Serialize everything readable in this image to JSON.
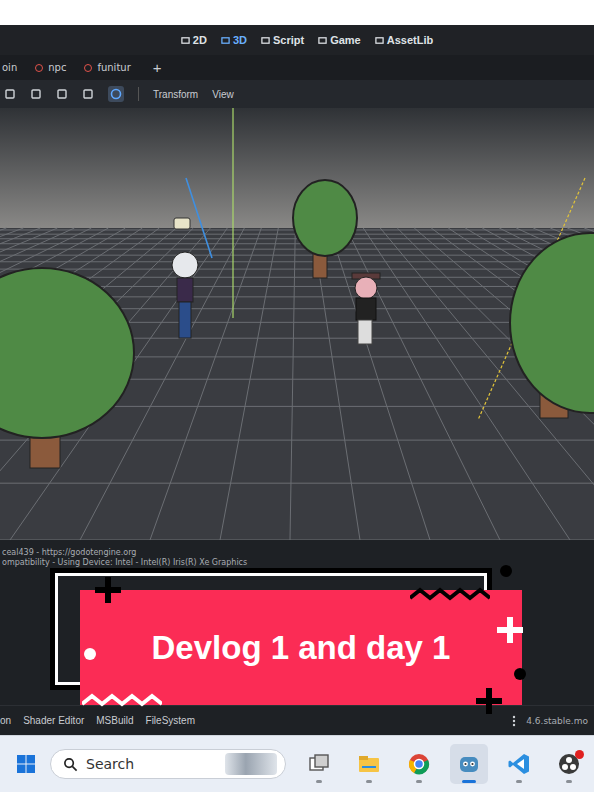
{
  "editor": {
    "main_tabs": [
      {
        "label": "2D",
        "selected": false
      },
      {
        "label": "3D",
        "selected": true
      },
      {
        "label": "Script",
        "selected": false
      },
      {
        "label": "Game",
        "selected": false
      },
      {
        "label": "AssetLib",
        "selected": false
      }
    ],
    "scene_tabs": [
      {
        "label": "oin",
        "icon": false
      },
      {
        "label": "npc",
        "icon": true
      },
      {
        "label": "funitur",
        "icon": true
      }
    ],
    "add_tab": "+",
    "toolbar": {
      "menus": [
        "Transform",
        "View"
      ]
    },
    "output": {
      "lines": [
        "ceal439 - https://godotengine.org",
        "ompatibility - Using Device: Intel - Intel(R) Iris(R) Xe Graphics"
      ]
    },
    "bottom_tabs": [
      {
        "label": "on"
      },
      {
        "label": "Shader Editor"
      },
      {
        "label": "MSBuild"
      },
      {
        "label": "FileSystem"
      }
    ],
    "version": "4.6.stable.mo"
  },
  "overlay": {
    "title": "Devlog 1 and day 1"
  },
  "taskbar": {
    "search": {
      "placeholder": "Search"
    },
    "apps": [
      {
        "kind": "task-view",
        "active": false,
        "badge": false
      },
      {
        "kind": "file-explorer",
        "active": false,
        "badge": false
      },
      {
        "kind": "chrome",
        "active": false,
        "badge": false
      },
      {
        "kind": "godot",
        "active": true,
        "badge": false
      },
      {
        "kind": "vscode",
        "active": false,
        "badge": false
      },
      {
        "kind": "obs",
        "active": false,
        "badge": true
      }
    ]
  }
}
